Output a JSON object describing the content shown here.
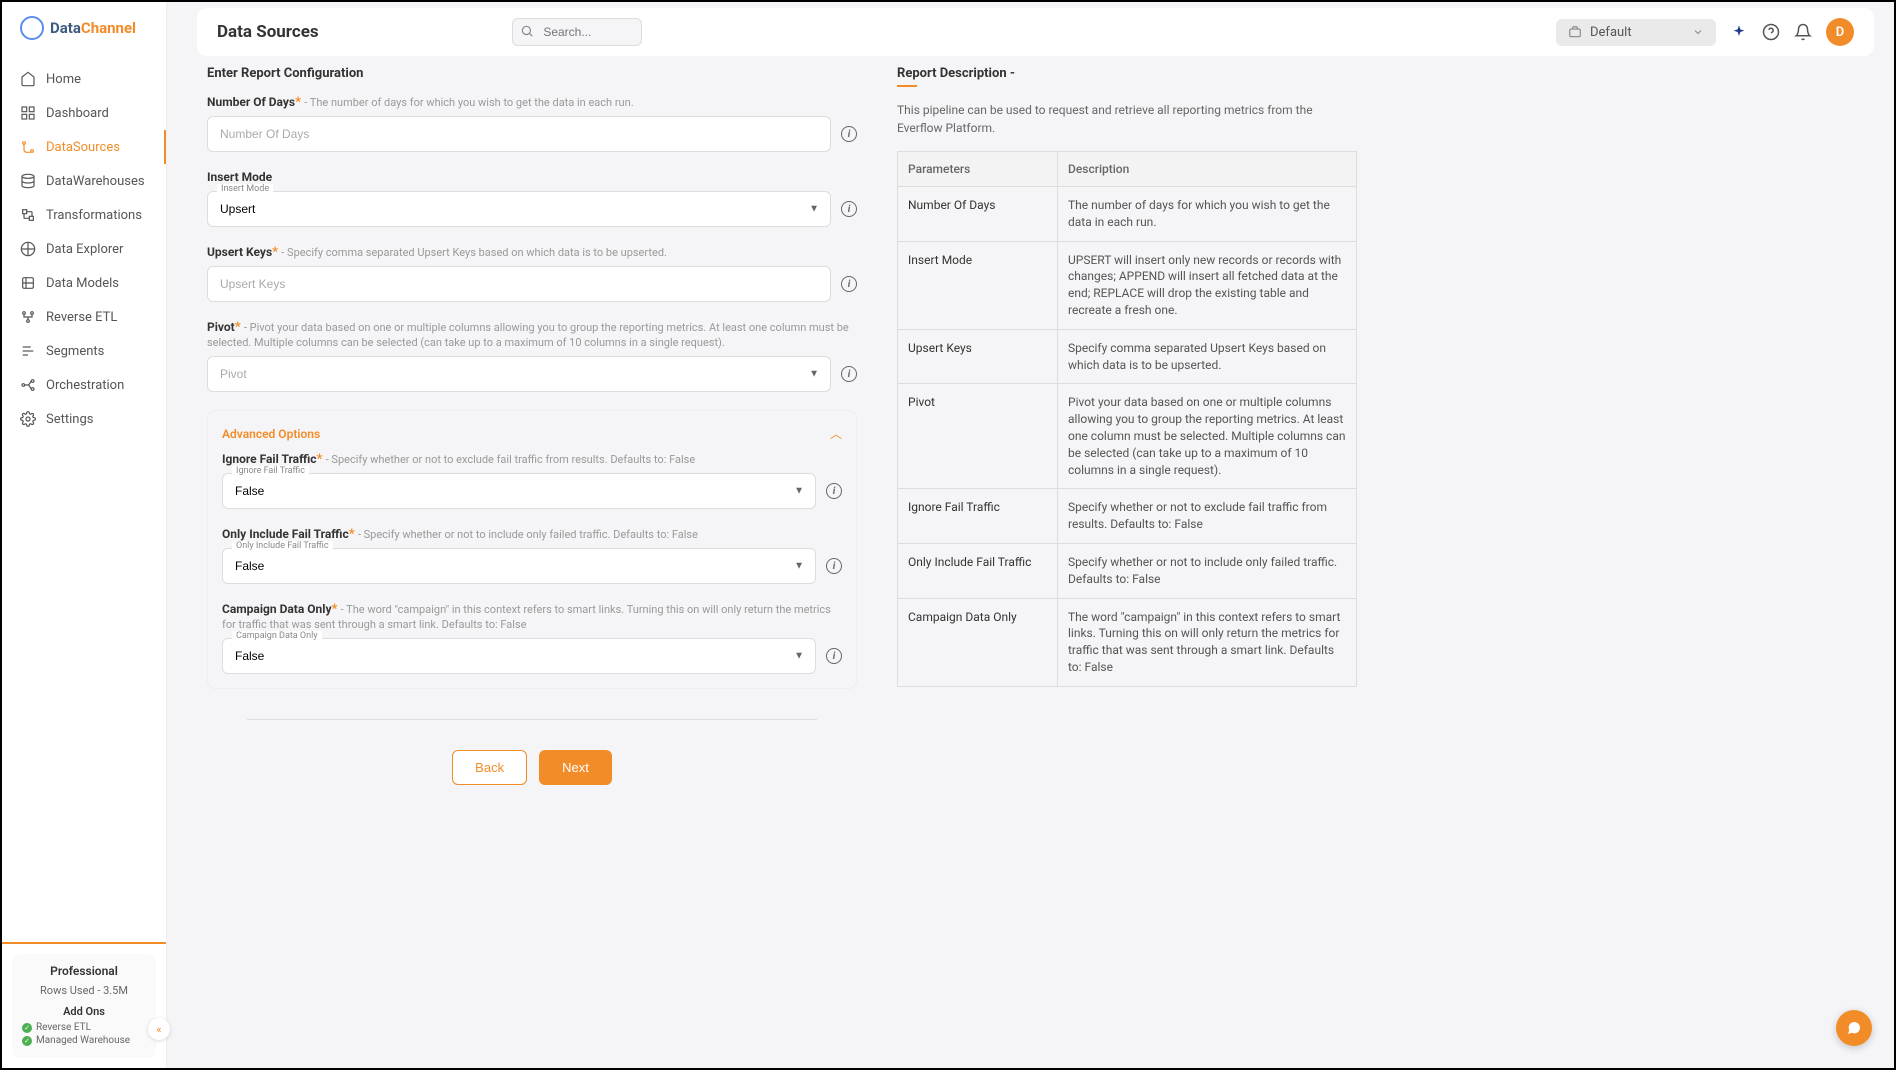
{
  "brand": {
    "part1": "Data",
    "part2": "Channel"
  },
  "nav": [
    {
      "label": "Home",
      "icon": "home"
    },
    {
      "label": "Dashboard",
      "icon": "dashboard"
    },
    {
      "label": "DataSources",
      "icon": "datasources",
      "active": true
    },
    {
      "label": "DataWarehouses",
      "icon": "warehouse"
    },
    {
      "label": "Transformations",
      "icon": "transform"
    },
    {
      "label": "Data Explorer",
      "icon": "explorer"
    },
    {
      "label": "Data Models",
      "icon": "models"
    },
    {
      "label": "Reverse ETL",
      "icon": "reverse"
    },
    {
      "label": "Segments",
      "icon": "segments"
    },
    {
      "label": "Orchestration",
      "icon": "orchestration"
    },
    {
      "label": "Settings",
      "icon": "settings"
    }
  ],
  "plan": {
    "name": "Professional",
    "rows_used": "Rows Used - 3.5M",
    "addons_title": "Add Ons",
    "addons": [
      "Reverse ETL",
      "Managed Warehouse"
    ]
  },
  "topbar": {
    "title": "Data Sources",
    "search_placeholder": "Search...",
    "workspace": "Default",
    "avatar_initial": "D"
  },
  "form": {
    "heading": "Enter Report Configuration",
    "number_of_days": {
      "label": "Number Of Days",
      "hint": "- The number of days for which you wish to get the data in each run.",
      "placeholder": "Number Of Days"
    },
    "insert_mode": {
      "label": "Insert Mode",
      "float": "Insert Mode",
      "value": "Upsert"
    },
    "upsert_keys": {
      "label": "Upsert Keys",
      "hint": "- Specify comma separated Upsert Keys based on which data is to be upserted.",
      "placeholder": "Upsert Keys"
    },
    "pivot": {
      "label": "Pivot",
      "hint": "- Pivot your data based on one or multiple columns allowing you to group the reporting metrics. At least one column must be selected. Multiple columns can be selected (can take up to a maximum of 10 columns in a single request).",
      "placeholder": "Pivot"
    },
    "advanced_title": "Advanced Options",
    "ignore_fail": {
      "label": "Ignore Fail Traffic",
      "hint": "- Specify whether or not to exclude fail traffic from results. Defaults to: False",
      "float": "Ignore Fail Traffic",
      "value": "False"
    },
    "only_fail": {
      "label": "Only Include Fail Traffic",
      "hint": "- Specify whether or not to include only failed traffic. Defaults to: False",
      "float": "Only Include Fail Traffic",
      "value": "False"
    },
    "campaign": {
      "label": "Campaign Data Only",
      "hint": "- The word \"campaign\" in this context refers to smart links. Turning this on will only return the metrics for traffic that was sent through a smart link. Defaults to: False",
      "float": "Campaign Data Only",
      "value": "False"
    },
    "back": "Back",
    "next": "Next"
  },
  "desc": {
    "title": "Report Description -",
    "text": "This pipeline can be used to request and retrieve all reporting metrics from the Everflow Platform.",
    "col_param": "Parameters",
    "col_desc": "Description",
    "rows": [
      {
        "p": "Number Of Days",
        "d": "The number of days for which you wish to get the data in each run."
      },
      {
        "p": "Insert Mode",
        "d": "UPSERT will insert only new records or records with changes; APPEND will insert all fetched data at the end; REPLACE will drop the existing table and recreate a fresh one."
      },
      {
        "p": "Upsert Keys",
        "d": "Specify comma separated Upsert Keys based on which data is to be upserted."
      },
      {
        "p": "Pivot",
        "d": "Pivot your data based on one or multiple columns allowing you to group the reporting metrics. At least one column must be selected. Multiple columns can be selected (can take up to a maximum of 10 columns in a single request)."
      },
      {
        "p": "Ignore Fail Traffic",
        "d": "Specify whether or not to exclude fail traffic from results. Defaults to: False"
      },
      {
        "p": "Only Include Fail Traffic",
        "d": "Specify whether or not to include only failed traffic. Defaults to: False"
      },
      {
        "p": "Campaign Data Only",
        "d": "The word \"campaign\" in this context refers to smart links. Turning this on will only return the metrics for traffic that was sent through a smart link. Defaults to: False"
      }
    ]
  }
}
